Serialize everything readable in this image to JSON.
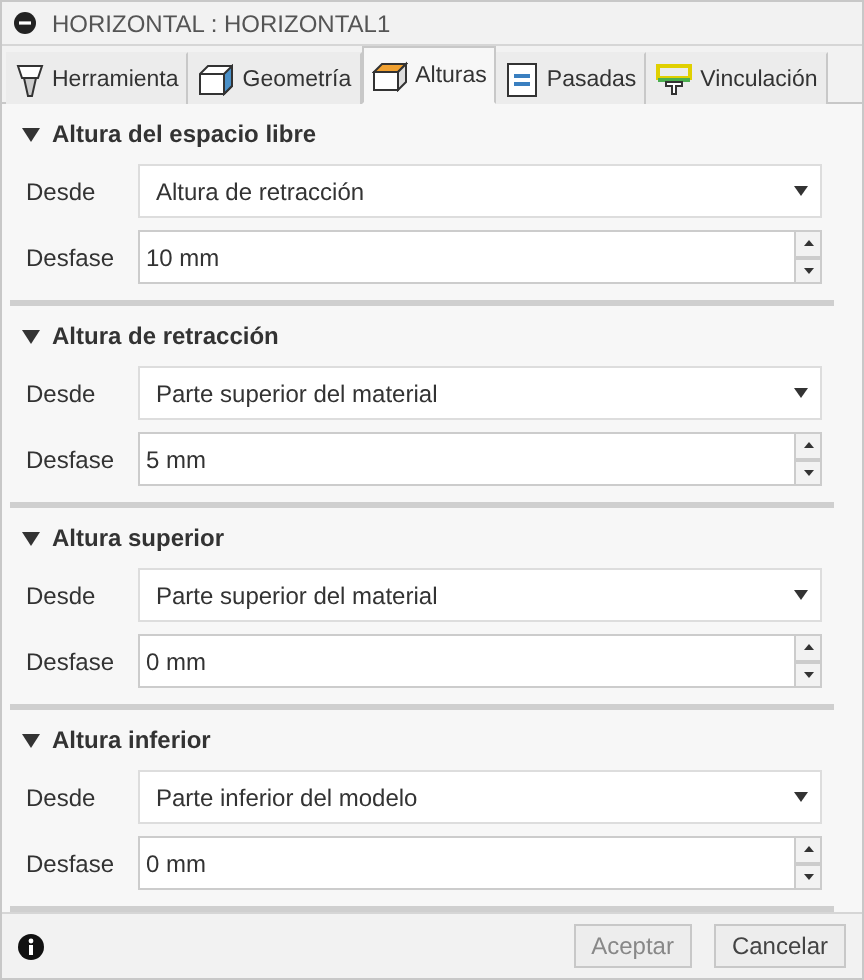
{
  "window": {
    "title": "HORIZONTAL : HORIZONTAL1"
  },
  "tabs": [
    {
      "label": "Herramienta",
      "kind": "tool",
      "selected": false
    },
    {
      "label": "Geometría",
      "kind": "geometry",
      "selected": false
    },
    {
      "label": "Alturas",
      "kind": "heights",
      "selected": true
    },
    {
      "label": "Pasadas",
      "kind": "passes",
      "selected": false
    },
    {
      "label": "Vinculación",
      "kind": "linking",
      "selected": false
    }
  ],
  "sections": [
    {
      "title": "Altura del espacio libre",
      "expanded": true,
      "from_label": "Desde",
      "from_value": "Altura de retracción",
      "offset_label": "Desfase",
      "offset_value": "10 mm"
    },
    {
      "title": "Altura de retracción",
      "expanded": true,
      "from_label": "Desde",
      "from_value": "Parte superior del material",
      "offset_label": "Desfase",
      "offset_value": "5 mm"
    },
    {
      "title": "Altura superior",
      "expanded": true,
      "from_label": "Desde",
      "from_value": "Parte superior del material",
      "offset_label": "Desfase",
      "offset_value": "0 mm"
    },
    {
      "title": "Altura inferior",
      "expanded": true,
      "from_label": "Desde",
      "from_value": "Parte inferior del modelo",
      "offset_label": "Desfase",
      "offset_value": "0 mm"
    }
  ],
  "buttons": [
    {
      "label": "Aceptar",
      "disabled": true
    },
    {
      "label": "Cancelar",
      "disabled": false
    }
  ]
}
